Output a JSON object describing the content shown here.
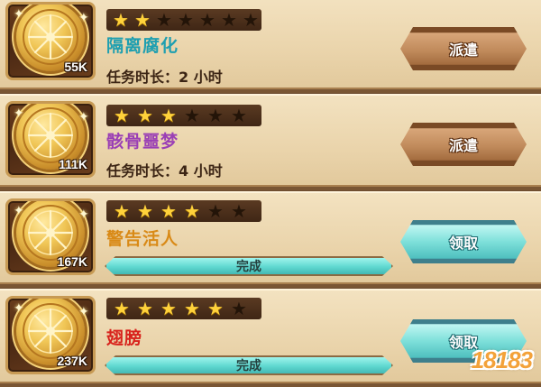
{
  "watermark": "18183",
  "tasks": [
    {
      "stars_on": 2,
      "stars_total": 7,
      "title": "隔离腐化",
      "title_color": "#1f9fb0",
      "reward": "55K",
      "duration": "任务时长：2 小时",
      "progress": null,
      "button": "派遣",
      "button_style": "brown"
    },
    {
      "stars_on": 3,
      "stars_total": 6,
      "title": "骸骨噩梦",
      "title_color": "#9a3fb5",
      "reward": "111K",
      "duration": "任务时长：4 小时",
      "progress": null,
      "button": "派遣",
      "button_style": "brown"
    },
    {
      "stars_on": 4,
      "stars_total": 6,
      "title": "警告活人",
      "title_color": "#d98a17",
      "reward": "167K",
      "duration": null,
      "progress": "完成",
      "button": "领取",
      "button_style": "teal"
    },
    {
      "stars_on": 5,
      "stars_total": 6,
      "title": "翅膀",
      "title_color": "#d8231c",
      "reward": "237K",
      "duration": null,
      "progress": "完成",
      "button": "领取",
      "button_style": "teal"
    }
  ]
}
